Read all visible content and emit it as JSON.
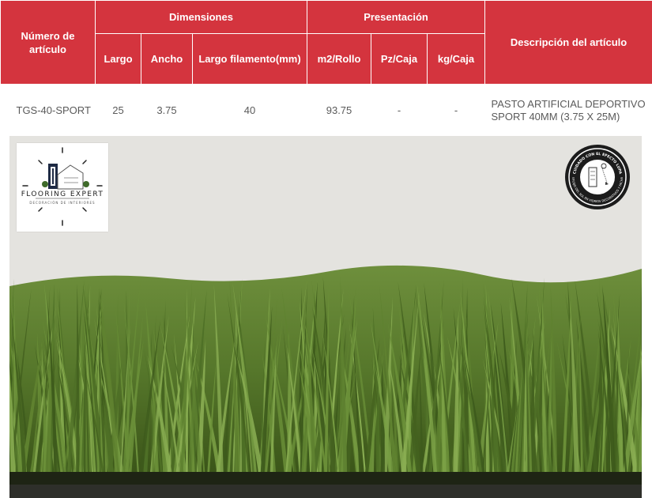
{
  "table": {
    "headers": {
      "numero": "Número de artículo",
      "dimensiones": "Dimensiones",
      "presentacion": "Presentación",
      "descripcion": "Descripción del artículo",
      "largo": "Largo",
      "ancho": "Ancho",
      "largo_filamento": "Largo filamento(mm)",
      "m2_rollo": "m2/Rollo",
      "pz_caja": "Pz/Caja",
      "kg_caja": "kg/Caja"
    },
    "row": {
      "numero": "TGS-40-SPORT",
      "largo": "25",
      "ancho": "3.75",
      "largo_filamento": "40",
      "m2_rollo": "93.75",
      "pz_caja": "-",
      "kg_caja": "-",
      "descripcion": "PASTO ARTIFICIAL DEPORTIVO SPORT 40MM (3.75 X 25M)"
    }
  },
  "logo": {
    "text": "FLOORING EXPERT",
    "subtext": "DECORACIÓN DE INTERIORES"
  },
  "badge": {
    "text_top": "CUIDADO CON EL EFECTO LUPA",
    "text_bottom": "EL REFLEJO DEL SOL EN VIDRIOS DECORATIVOS Y FACHADAS"
  },
  "colors": {
    "header_red": "#d4343e",
    "grass_dark": "#3d5a1c",
    "grass_light": "#7aa045"
  }
}
